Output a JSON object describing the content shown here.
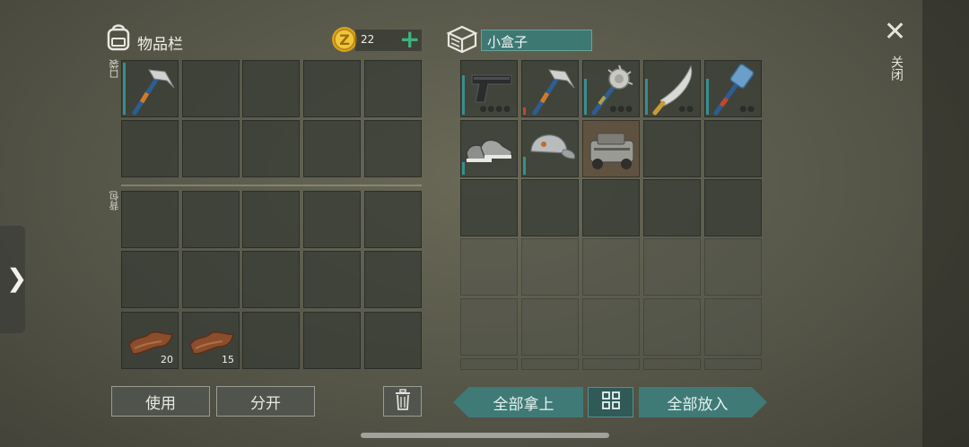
{
  "inventory": {
    "title": "物品栏",
    "currency_count": "22",
    "pocket_label": "口袋",
    "backpack_label": "背包",
    "items": [
      {
        "name": "hammer",
        "icon": "hammer-icon"
      },
      {
        "name": "leather-1",
        "icon": "leather-icon",
        "qty": "20"
      },
      {
        "name": "leather-2",
        "icon": "leather-icon",
        "qty": "15"
      }
    ]
  },
  "container": {
    "name_value": "小盒子",
    "items": [
      "pistol-icon",
      "hammer-icon",
      "spiked-mace-icon",
      "machete-icon",
      "sledgehammer-icon",
      "sneakers-icon",
      "cap-icon",
      "vehicle-icon"
    ]
  },
  "buttons": {
    "use": "使用",
    "split": "分开",
    "take_all": "全部拿上",
    "put_all": "全部放入",
    "close": "关闭"
  },
  "colors": {
    "accent_teal": "#3f7a77",
    "currency_gold": "#e6b627",
    "plus_green": "#3fb27f"
  }
}
